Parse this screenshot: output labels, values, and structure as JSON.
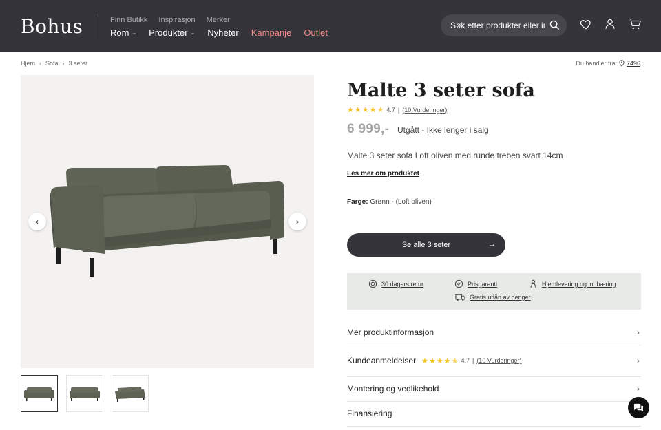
{
  "header": {
    "logo": "Bohus",
    "top_links": [
      "Finn Butikk",
      "Inspirasjon",
      "Merker"
    ],
    "nav": [
      {
        "label": "Rom",
        "has_dropdown": true,
        "promo": false
      },
      {
        "label": "Produkter",
        "has_dropdown": true,
        "promo": false
      },
      {
        "label": "Nyheter",
        "has_dropdown": false,
        "promo": false
      },
      {
        "label": "Kampanje",
        "has_dropdown": false,
        "promo": true
      },
      {
        "label": "Outlet",
        "has_dropdown": false,
        "promo": true
      }
    ],
    "search_placeholder": "Søk etter produkter eller innl",
    "icons": [
      "search-icon",
      "heart-icon",
      "user-icon",
      "cart-icon"
    ]
  },
  "breadcrumb": [
    "Hjem",
    "Sofa",
    "3 seter"
  ],
  "store": {
    "label": "Du handler fra:",
    "number": "7496"
  },
  "gallery": {
    "thumb_count": 3
  },
  "product": {
    "title": "Malte 3 seter sofa",
    "rating_value": "4.7",
    "rating_stars": 4.5,
    "rating_link": "(10 Vurderinger)",
    "price": "6 999,-",
    "status": "Utgått - Ikke lenger i salg",
    "description": "Malte 3 seter sofa Loft oliven med runde treben svart 14cm",
    "read_more": "Les mer om produktet",
    "color_label": "Farge:",
    "color_value": "Grønn - (Loft oliven)",
    "cta": "Se alle 3 seter"
  },
  "usps": [
    "30 dagers retur",
    "Prisgaranti",
    "Hjemlevering og innbæring",
    "Gratis utlån av henger"
  ],
  "accordion": [
    {
      "label": "Mer produktinformasjon"
    },
    {
      "label": "Kundeanmeldelser",
      "rating_value": "4.7",
      "rating_link": "(10 Vurderinger)"
    },
    {
      "label": "Montering og vedlikehold"
    },
    {
      "label": "Finansiering"
    }
  ],
  "colors": {
    "header_bg": "#35343a",
    "promo": "#f28a84",
    "star": "#f2c21b",
    "usp_bg": "#e7eae7",
    "sofa": "#5d6254"
  }
}
